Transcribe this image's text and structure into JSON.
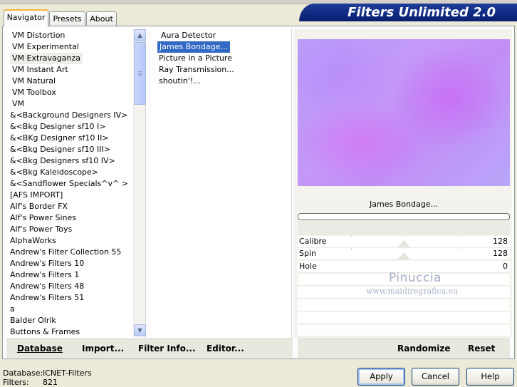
{
  "brand": "Filters Unlimited 2.0",
  "tabs": [
    {
      "label": "Navigator",
      "active": true
    },
    {
      "label": "Presets",
      "active": false
    },
    {
      "label": "About",
      "active": false
    }
  ],
  "categories": [
    "VM Distortion",
    "VM Experimental",
    "VM Extravaganza",
    "VM Instant Art",
    "VM Natural",
    "VM Toolbox",
    "VM",
    "&<Background Designers IV>",
    "&<Bkg Designer sf10 I>",
    "&<BKg Designer sf10 II>",
    "&<Bkg Designer sf10 III>",
    "&<Bkg Designers sf10 IV>",
    "&<Bkg Kaleidoscope>",
    "&<Sandflower Specials^v^ >",
    "[AFS IMPORT]",
    "Alf's Border FX",
    "Alf's Power Sines",
    "Alf's Power Toys",
    "AlphaWorks",
    "Andrew's Filter Collection 55",
    "Andrew's Filters 10",
    "Andrew's Filters 1",
    "Andrew's Filters 48",
    "Andrew's Filters 51",
    "a",
    "Balder Olrik",
    "Buttons & Frames"
  ],
  "selected_category": "VM Extravaganza",
  "filters": [
    "Aura Detector",
    "James Bondage...",
    "Picture in a Picture",
    "Ray Transmission...",
    "shoutin'!..."
  ],
  "selected_filter": "James Bondage...",
  "preview_filter_name": "James Bondage...",
  "params": [
    {
      "label": "Calibre",
      "value": "128"
    },
    {
      "label": "Spin",
      "value": "128"
    },
    {
      "label": "Hole",
      "value": "0"
    }
  ],
  "watermark": {
    "name": "Pinuccia",
    "url": "www.maidiregrafica.eu"
  },
  "left_buttons": {
    "database": "Database",
    "import": "Import...",
    "filter_info": "Filter Info...",
    "editor": "Editor..."
  },
  "right_buttons": {
    "randomize": "Randomize",
    "reset": "Reset"
  },
  "status": {
    "db_label": "Database:",
    "db_value": "ICNET-Filters",
    "filters_label": "Filters:",
    "filters_value": "821"
  },
  "dialog_buttons": {
    "apply": "Apply",
    "cancel": "Cancel",
    "help": "Help"
  },
  "colors": {
    "accent_blue": "#0f2a80",
    "selection": "#316ac5",
    "tab_highlight": "#f8b33b"
  }
}
